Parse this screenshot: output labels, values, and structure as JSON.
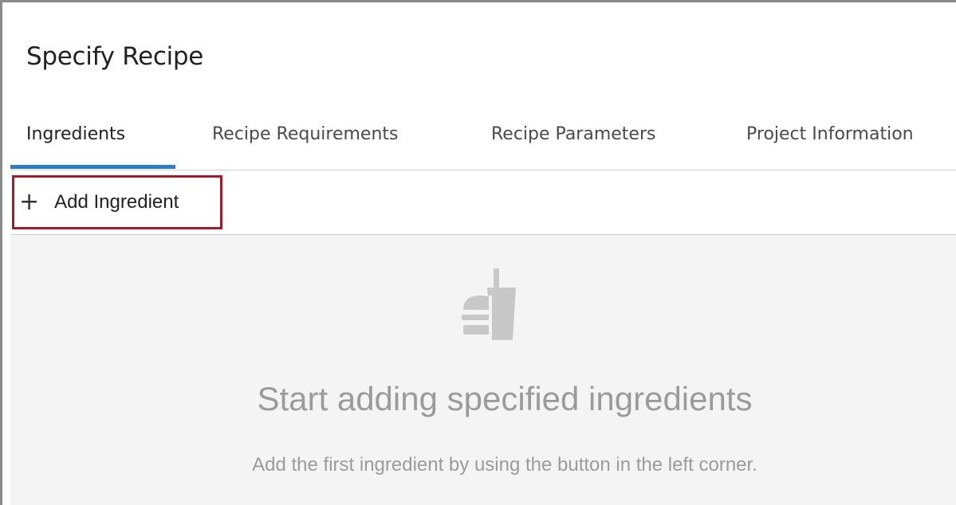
{
  "page": {
    "title": "Specify Recipe"
  },
  "tabs": [
    {
      "label": "Ingredients",
      "active": true
    },
    {
      "label": "Recipe Requirements",
      "active": false
    },
    {
      "label": "Recipe Parameters",
      "active": false
    },
    {
      "label": "Project Information",
      "active": false
    }
  ],
  "toolbar": {
    "add_icon": "+",
    "add_label": "Add Ingredient"
  },
  "empty_state": {
    "icon": "food-drink-icon",
    "title": "Start adding specified ingredients",
    "subtitle": "Add the first ingredient by using the button in the left corner."
  },
  "colors": {
    "tab_active_underline": "#2b7cc6",
    "highlight_border": "#a21b2a",
    "empty_text": "#9b9b9b",
    "empty_background": "#f4f4f4"
  }
}
